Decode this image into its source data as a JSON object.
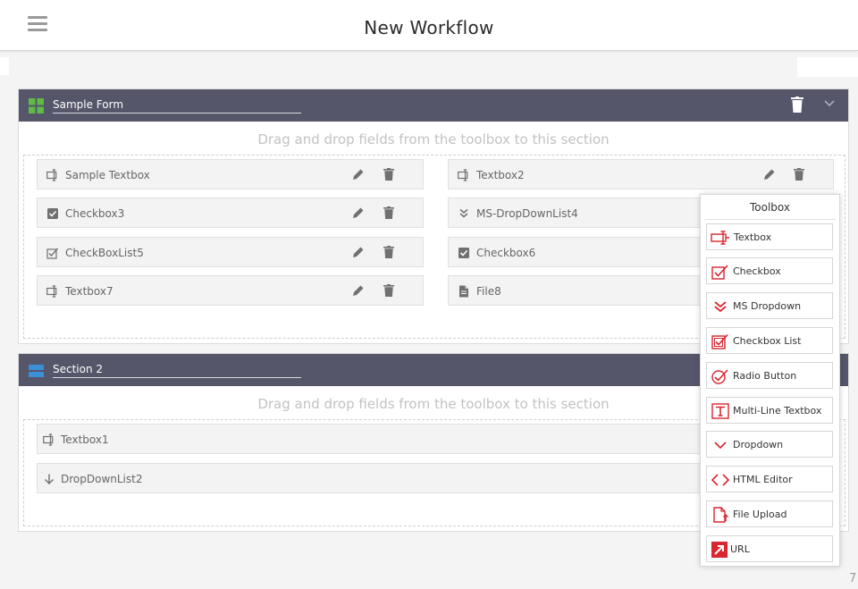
{
  "header": {
    "title": "New Workflow",
    "menu_icon": "hamburger-menu-icon"
  },
  "drop_hint": "Drag and drop fields from the toolbox to this section",
  "sections": [
    {
      "title": "Sample Form",
      "icon": "grid-icon",
      "icon_color": "#5fba46",
      "fields": [
        {
          "label": "Sample Textbox",
          "icon": "textbox-icon"
        },
        {
          "label": "Textbox2",
          "icon": "textbox-icon"
        },
        {
          "label": "Checkbox3",
          "icon": "checkbox-icon"
        },
        {
          "label": "MS-DropDownList4",
          "icon": "double-chevron-icon"
        },
        {
          "label": "CheckBoxList5",
          "icon": "checkbox-list-icon"
        },
        {
          "label": "Checkbox6",
          "icon": "checkbox-icon"
        },
        {
          "label": "Textbox7",
          "icon": "textbox-icon"
        },
        {
          "label": "File8",
          "icon": "file-icon"
        }
      ]
    },
    {
      "title": "Section 2",
      "icon": "section-icon",
      "icon_color": "#3a8fd6",
      "fields": [
        {
          "label": "Textbox1",
          "icon": "textbox-icon"
        },
        {
          "label": "DropDownList2",
          "icon": "arrow-down-icon"
        }
      ]
    }
  ],
  "toolbox": {
    "title": "Toolbox",
    "items": [
      {
        "label": "Textbox",
        "icon": "textbox-icon"
      },
      {
        "label": "Checkbox",
        "icon": "checkbox-icon"
      },
      {
        "label": "MS Dropdown",
        "icon": "double-chevron-icon"
      },
      {
        "label": "Checkbox List",
        "icon": "checkbox-list-icon"
      },
      {
        "label": "Radio Button",
        "icon": "radio-button-icon"
      },
      {
        "label": "Multi-Line Textbox",
        "icon": "multiline-text-icon"
      },
      {
        "label": "Dropdown",
        "icon": "chevron-down-icon"
      },
      {
        "label": "HTML Editor",
        "icon": "code-icon"
      },
      {
        "label": "File Upload",
        "icon": "file-upload-icon"
      },
      {
        "label": "URL",
        "icon": "link-icon"
      }
    ]
  },
  "colors": {
    "header_bar": "#55566a",
    "toolbox_accent": "#d9262f",
    "field_icon": "#707070"
  },
  "corner_number": "7"
}
